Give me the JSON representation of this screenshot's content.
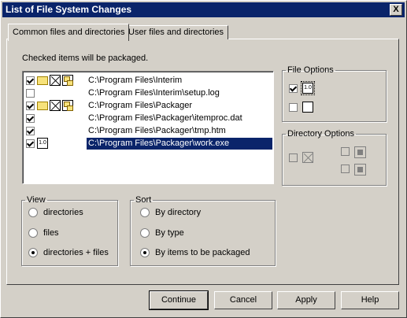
{
  "window": {
    "title": "List of File System Changes",
    "close_glyph": "X"
  },
  "tabs": [
    {
      "label": "Common files and directories",
      "active": true
    },
    {
      "label": "User files and directories",
      "active": false
    }
  ],
  "hint": "Checked items will be packaged.",
  "files": [
    {
      "path": "C:\\Program Files\\Interim",
      "checked": true,
      "icons": [
        "folder-icon",
        "exclude-icon",
        "folders-icon"
      ]
    },
    {
      "path": "C:\\Program Files\\Interim\\setup.log",
      "checked": false,
      "icons": []
    },
    {
      "path": "C:\\Program Files\\Packager",
      "checked": true,
      "icons": [
        "folder-icon",
        "exclude-icon",
        "folders-icon"
      ]
    },
    {
      "path": "C:\\Program Files\\Packager\\itemproc.dat",
      "checked": true,
      "icons": []
    },
    {
      "path": "C:\\Program Files\\Packager\\tmp.htm",
      "checked": true,
      "icons": []
    },
    {
      "path": "C:\\Program Files\\Packager\\work.exe",
      "checked": true,
      "icons": [
        "version-icon"
      ],
      "selected": true
    }
  ],
  "file_options": {
    "legend": "File Options",
    "version_icon_text": "1.0",
    "options": [
      {
        "checked": true
      },
      {
        "checked": false
      }
    ]
  },
  "directory_options": {
    "legend": "Directory Options"
  },
  "view": {
    "legend": "View",
    "options": [
      {
        "label": "directories",
        "checked": false
      },
      {
        "label": "files",
        "checked": false
      },
      {
        "label": "directories + files",
        "checked": true
      }
    ]
  },
  "sort": {
    "legend": "Sort",
    "options": [
      {
        "label": "By directory",
        "checked": false
      },
      {
        "label": "By type",
        "checked": false
      },
      {
        "label": "By items to be packaged",
        "checked": true
      }
    ]
  },
  "buttons": {
    "continue": "Continue",
    "cancel": "Cancel",
    "apply": "Apply",
    "help": "Help"
  }
}
